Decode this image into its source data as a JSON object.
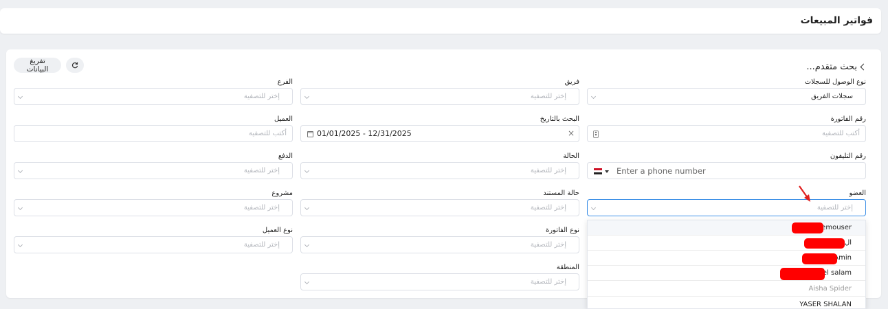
{
  "page": {
    "title": "فواتير المبيعات"
  },
  "toolbar": {
    "advanced_search": "بحث متقدم...",
    "clear_label": "تفريغ البيانات",
    "refresh_icon": "refresh-icon"
  },
  "filters": {
    "access_type": {
      "label": "نوع الوصول للسجلات",
      "value": "سجلات الفريق"
    },
    "team": {
      "label": "فريق",
      "placeholder": "إختر للتصفية"
    },
    "branch": {
      "label": "الفرع",
      "placeholder": "إختر للتصفية"
    },
    "invoice_number": {
      "label": "رقم الفاتورة",
      "placeholder": "أكتب للتصفية"
    },
    "date_search": {
      "label": "البحث بالتاريخ",
      "value": "01/01/2025 - 12/31/2025"
    },
    "customer": {
      "label": "العميل",
      "placeholder": "أكتب للتصفية"
    },
    "phone": {
      "label": "رقم التليفون",
      "placeholder": "Enter a phone number"
    },
    "status": {
      "label": "الحالة",
      "placeholder": "إختر للتصفية"
    },
    "payment": {
      "label": "الدفع",
      "placeholder": "إختر للتصفية"
    },
    "member": {
      "label": "العضو",
      "placeholder": "إختر للتصفية"
    },
    "document_status": {
      "label": "حالة المستند",
      "placeholder": "إختر للتصفية"
    },
    "project": {
      "label": "مشروع",
      "placeholder": "إختر للتصفية"
    },
    "invoice_type": {
      "label": "نوع الفاتورة",
      "placeholder": "إختر للتصفية"
    },
    "customer_type": {
      "label": "نوع العميل",
      "placeholder": "إختر للتصفية"
    },
    "region": {
      "label": "المنطقة",
      "placeholder": "إختر للتصفية"
    }
  },
  "member_dropdown": {
    "options": [
      "demouser",
      "ال",
      "Amin",
      "el salam",
      "Aisha Spider",
      "YASER SHALAN"
    ]
  },
  "colors": {
    "accent": "#3a8ee6",
    "redaction": "#ff0000",
    "annotation_arrow": "#e02020"
  }
}
